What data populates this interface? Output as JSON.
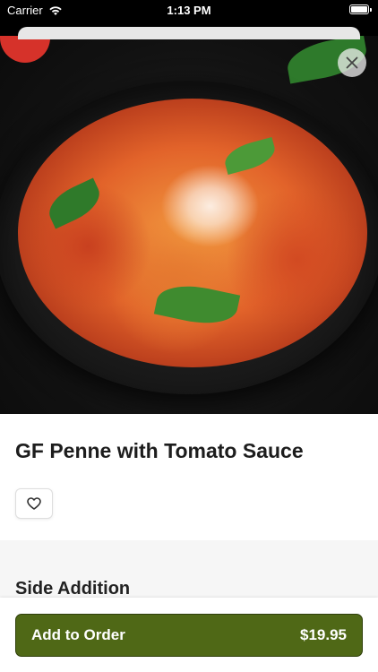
{
  "status_bar": {
    "carrier": "Carrier",
    "time": "1:13 PM"
  },
  "item": {
    "title": "GF Penne with Tomato Sauce"
  },
  "sections": {
    "side_addition": "Side Addition"
  },
  "order_button": {
    "label": "Add to Order",
    "price": "$19.95"
  },
  "colors": {
    "accent": "#4f6816",
    "section_bg": "#f6f6f6"
  },
  "icons": {
    "close": "close-icon",
    "favorite": "heart-outline-icon",
    "wifi": "wifi-icon"
  }
}
